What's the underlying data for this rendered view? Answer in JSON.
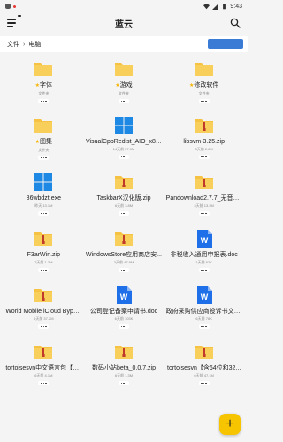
{
  "status": {
    "time": "9:43"
  },
  "app": {
    "title": "蓝云"
  },
  "breadcrumb": [
    "文件",
    "电脑"
  ],
  "files": [
    {
      "name": "字体",
      "meta": "文件夹",
      "icon": "folder-icon",
      "starred": true
    },
    {
      "name": "游戏",
      "meta": "文件夹",
      "icon": "folder-icon",
      "starred": true
    },
    {
      "name": "修改软件",
      "meta": "文件夹",
      "icon": "folder-icon",
      "starred": true
    },
    {
      "name": "图集",
      "meta": "文件夹",
      "icon": "folder-icon",
      "starred": true
    },
    {
      "name": "VisualCppRedist_AIO_x86_...",
      "meta": "14天前  27.9M",
      "icon": "windows-icon",
      "starred": false
    },
    {
      "name": "libsvm-3.25.zip",
      "meta": "3天前  2.8M",
      "icon": "zip-icon",
      "starred": false
    },
    {
      "name": "86wbdzt.exe",
      "meta": "昨天  13.1M",
      "icon": "windows-icon",
      "starred": false
    },
    {
      "name": "TaskbarX汉化版.zip",
      "meta": "6天前  3.8M",
      "icon": "zip-icon",
      "starred": false
    },
    {
      "name": "Pandownload2.7.7_无音仔...",
      "meta": "3天前  13.2M",
      "icon": "zip-icon",
      "starred": false
    },
    {
      "name": "F3arWin.zip",
      "meta": "7天前  1.3M",
      "icon": "zip-icon",
      "starred": false
    },
    {
      "name": "WindowsStore应用商店安...",
      "meta": "3天前  47.9M",
      "icon": "zip-icon",
      "starred": false
    },
    {
      "name": "非税收入通用申报表.doc",
      "meta": "1天前  62K",
      "icon": "word-icon",
      "starred": false
    },
    {
      "name": "World Mobile iCloud Bypas...",
      "meta": "6天前  37.2M",
      "icon": "zip-icon",
      "starred": false
    },
    {
      "name": "公司登记备案申请书.doc",
      "meta": "6天前  103K",
      "icon": "word-icon",
      "starred": false
    },
    {
      "name": "政府采购供应商投诉书文本...",
      "meta": "6天前  78K",
      "icon": "word-icon",
      "starred": false
    },
    {
      "name": "tortoisesvn中文语言包【含...",
      "meta": "6天前  4.1M",
      "icon": "zip-icon",
      "starred": false
    },
    {
      "name": "数码小站beta_0.0.7.zip",
      "meta": "6天前  1.3M",
      "icon": "zip-icon",
      "starred": false
    },
    {
      "name": "tortoisesvn【含64位和32...",
      "meta": "6天前  47.1M",
      "icon": "zip-icon",
      "starred": false
    }
  ],
  "fab": {
    "label": "+"
  },
  "colors": {
    "folder": "#f6c243",
    "zip": "#f6c243",
    "windows": "#1e88e5",
    "word": "#1e6fe8",
    "accent": "#f7c400"
  }
}
